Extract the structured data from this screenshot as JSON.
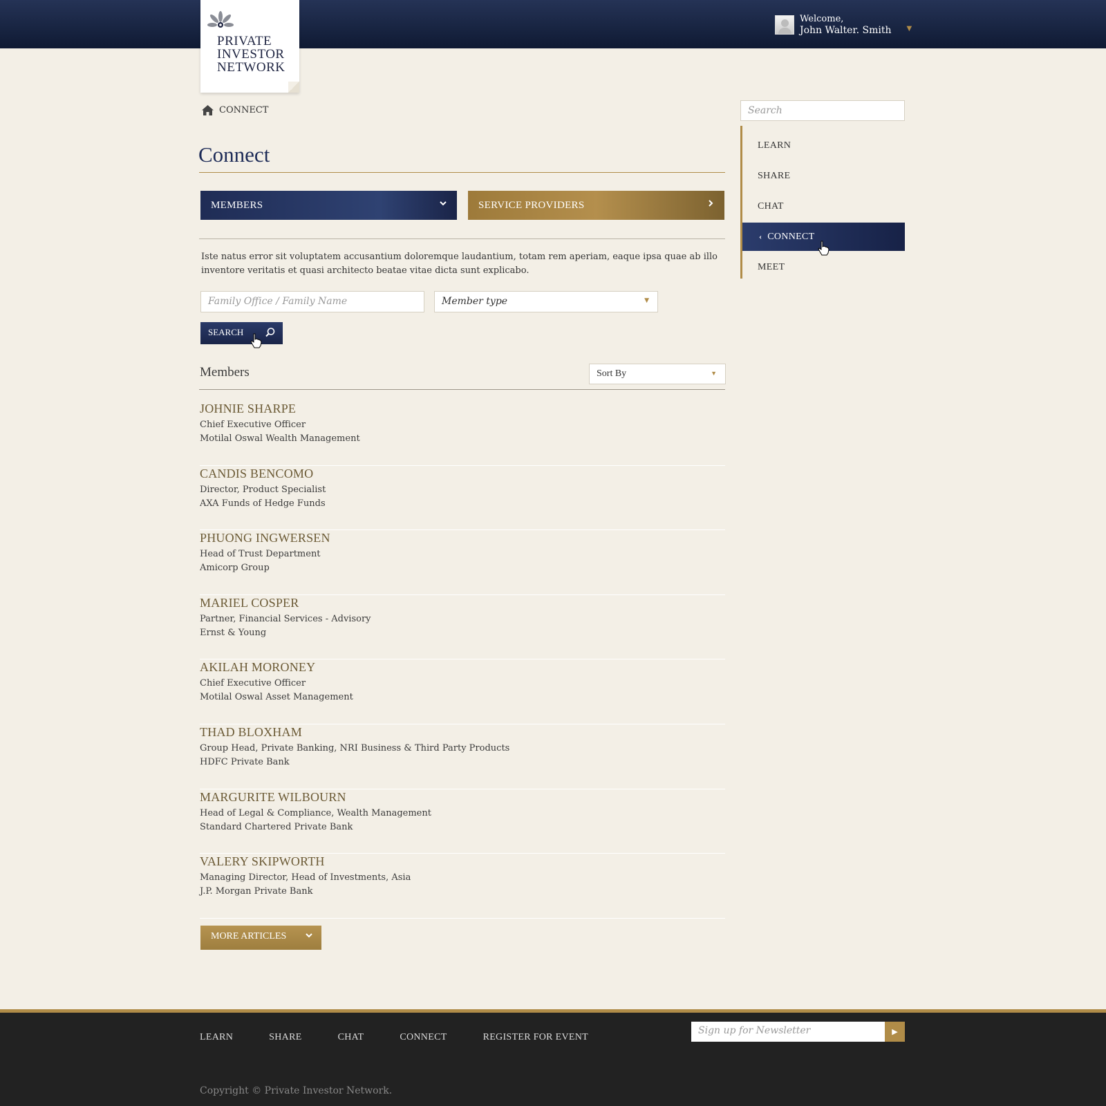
{
  "header": {
    "welcome": "Welcome,",
    "user_name": "John Walter. Smith",
    "caret": "▼"
  },
  "logo": {
    "line1": "PRIVATE",
    "line2": "INVESTOR",
    "line3": "NETWORK"
  },
  "breadcrumb": {
    "label": "CONNECT"
  },
  "page": {
    "title": "Connect",
    "tabs": [
      {
        "label": "MEMBERS",
        "icon": "chevron-down-icon",
        "glyph": "⌄"
      },
      {
        "label": "SERVICE PROVIDERS",
        "icon": "chevron-right-icon",
        "glyph": "›"
      }
    ],
    "intro": "Iste natus error sit voluptatem accusantium doloremque laudantium, totam rem aperiam, eaque ipsa quae ab illo inventore veritatis et quasi architecto beatae vitae dicta sunt explicabo.",
    "filters": {
      "name_placeholder": "Family Office / Family Name",
      "member_type": "Member type"
    },
    "search_label": "SEARCH",
    "members_heading": "Members",
    "sort_label": "Sort By",
    "more_label": "MORE ARTICLES"
  },
  "members": [
    {
      "name": "JOHNIE SHARPE",
      "title": "Chief Executive Officer",
      "company": "Motilal Oswal Wealth Management"
    },
    {
      "name": "CANDIS BENCOMO",
      "title": "Director, Product Specialist",
      "company": "AXA Funds of Hedge Funds"
    },
    {
      "name": "PHUONG INGWERSEN",
      "title": "Head of Trust Department",
      "company": "Amicorp Group"
    },
    {
      "name": "MARIEL COSPER",
      "title": "Partner, Financial Services - Advisory",
      "company": "Ernst & Young"
    },
    {
      "name": "AKILAH MORONEY",
      "title": "Chief Executive Officer",
      "company": "Motilal Oswal Asset Management"
    },
    {
      "name": "THAD BLOXHAM",
      "title": "Group Head, Private Banking, NRI Business & Third Party Products",
      "company": "HDFC Private Bank"
    },
    {
      "name": "MARGURITE WILBOURN",
      "title": "Head of Legal & Compliance, Wealth Management",
      "company": "Standard Chartered Private Bank"
    },
    {
      "name": "VALERY SKIPWORTH",
      "title": "Managing Director, Head of Investments, Asia",
      "company": "J.P. Morgan Private Bank"
    }
  ],
  "sidebar": {
    "search_placeholder": "Search",
    "items": [
      {
        "label": "LEARN",
        "active": false
      },
      {
        "label": "SHARE",
        "active": false
      },
      {
        "label": "CHAT",
        "active": false
      },
      {
        "label": "CONNECT",
        "active": true
      },
      {
        "label": "MEET",
        "active": false
      }
    ]
  },
  "footer": {
    "links": [
      "LEARN",
      "SHARE",
      "CHAT",
      "CONNECT",
      "REGISTER FOR EVENT"
    ],
    "newsletter_placeholder": "Sign up for Newsletter",
    "submit_glyph": "▶",
    "copyright": "Copyright © Private Investor Network."
  },
  "colors": {
    "navy": "#1d2b57",
    "gold": "#b08c48",
    "background": "#f3efe6",
    "footer": "#222222"
  }
}
